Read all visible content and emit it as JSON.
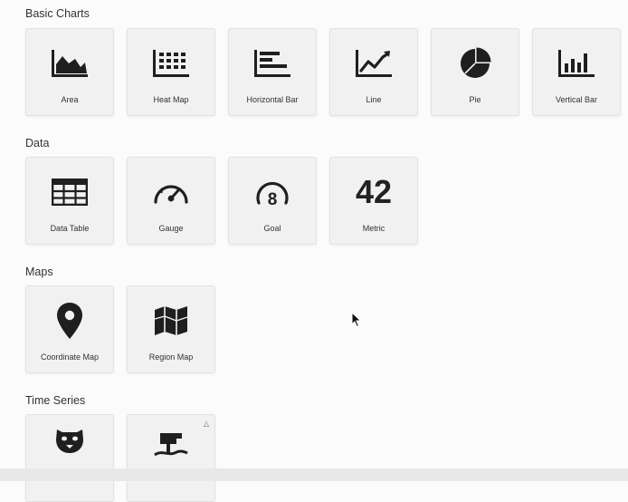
{
  "sections": [
    {
      "title": "Basic Charts",
      "items": [
        {
          "label": "Area",
          "icon": "area-chart-icon"
        },
        {
          "label": "Heat Map",
          "icon": "heat-map-icon"
        },
        {
          "label": "Horizontal Bar",
          "icon": "horizontal-bar-icon"
        },
        {
          "label": "Line",
          "icon": "line-chart-icon"
        },
        {
          "label": "Pie",
          "icon": "pie-chart-icon"
        },
        {
          "label": "Vertical Bar",
          "icon": "vertical-bar-icon"
        }
      ]
    },
    {
      "title": "Data",
      "items": [
        {
          "label": "Data Table",
          "icon": "table-icon"
        },
        {
          "label": "Gauge",
          "icon": "gauge-icon"
        },
        {
          "label": "Goal",
          "icon": "goal-icon",
          "icon_text": "8"
        },
        {
          "label": "Metric",
          "icon": "metric-icon",
          "icon_text": "42"
        }
      ]
    },
    {
      "title": "Maps",
      "items": [
        {
          "label": "Coordinate Map",
          "icon": "map-pin-icon"
        },
        {
          "label": "Region Map",
          "icon": "region-map-icon"
        }
      ]
    },
    {
      "title": "Time Series",
      "items": [
        {
          "label": "",
          "icon": "timelion-icon"
        },
        {
          "label": "",
          "icon": "tsvb-icon",
          "badge": "flask-icon"
        }
      ]
    }
  ]
}
